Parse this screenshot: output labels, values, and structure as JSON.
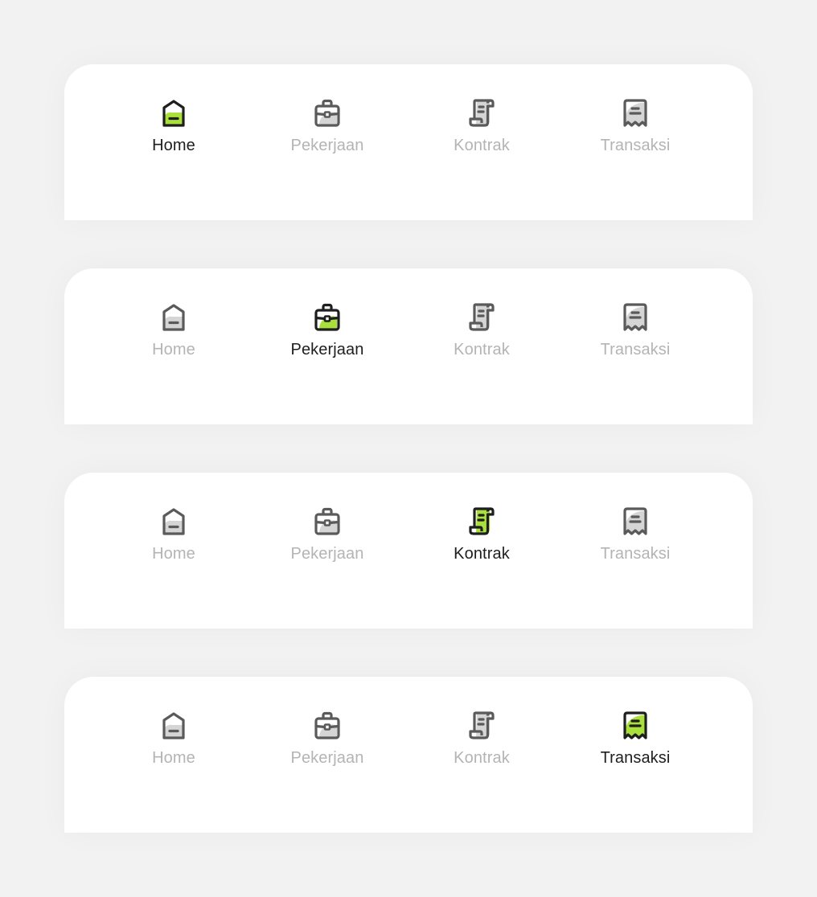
{
  "colors": {
    "accent": "#a9e03c",
    "active_stroke": "#1e1e1e",
    "inactive_stroke": "#5a5a5a",
    "inactive_fill": "#d5d5d5",
    "active_label": "#1e1e1e",
    "inactive_label": "#b4b4b4"
  },
  "navbars": [
    {
      "active": "home",
      "items": [
        {
          "key": "home",
          "label": "Home",
          "icon": "home-icon"
        },
        {
          "key": "pekerjaan",
          "label": "Pekerjaan",
          "icon": "briefcase-icon"
        },
        {
          "key": "kontrak",
          "label": "Kontrak",
          "icon": "contract-scroll-icon"
        },
        {
          "key": "transaksi",
          "label": "Transaksi",
          "icon": "receipt-icon"
        }
      ]
    },
    {
      "active": "pekerjaan",
      "items": [
        {
          "key": "home",
          "label": "Home",
          "icon": "home-icon"
        },
        {
          "key": "pekerjaan",
          "label": "Pekerjaan",
          "icon": "briefcase-icon"
        },
        {
          "key": "kontrak",
          "label": "Kontrak",
          "icon": "contract-scroll-icon"
        },
        {
          "key": "transaksi",
          "label": "Transaksi",
          "icon": "receipt-icon"
        }
      ]
    },
    {
      "active": "kontrak",
      "items": [
        {
          "key": "home",
          "label": "Home",
          "icon": "home-icon"
        },
        {
          "key": "pekerjaan",
          "label": "Pekerjaan",
          "icon": "briefcase-icon"
        },
        {
          "key": "kontrak",
          "label": "Kontrak",
          "icon": "contract-scroll-icon"
        },
        {
          "key": "transaksi",
          "label": "Transaksi",
          "icon": "receipt-icon"
        }
      ]
    },
    {
      "active": "transaksi",
      "items": [
        {
          "key": "home",
          "label": "Home",
          "icon": "home-icon"
        },
        {
          "key": "pekerjaan",
          "label": "Pekerjaan",
          "icon": "briefcase-icon"
        },
        {
          "key": "kontrak",
          "label": "Kontrak",
          "icon": "contract-scroll-icon"
        },
        {
          "key": "transaksi",
          "label": "Transaksi",
          "icon": "receipt-icon"
        }
      ]
    }
  ]
}
